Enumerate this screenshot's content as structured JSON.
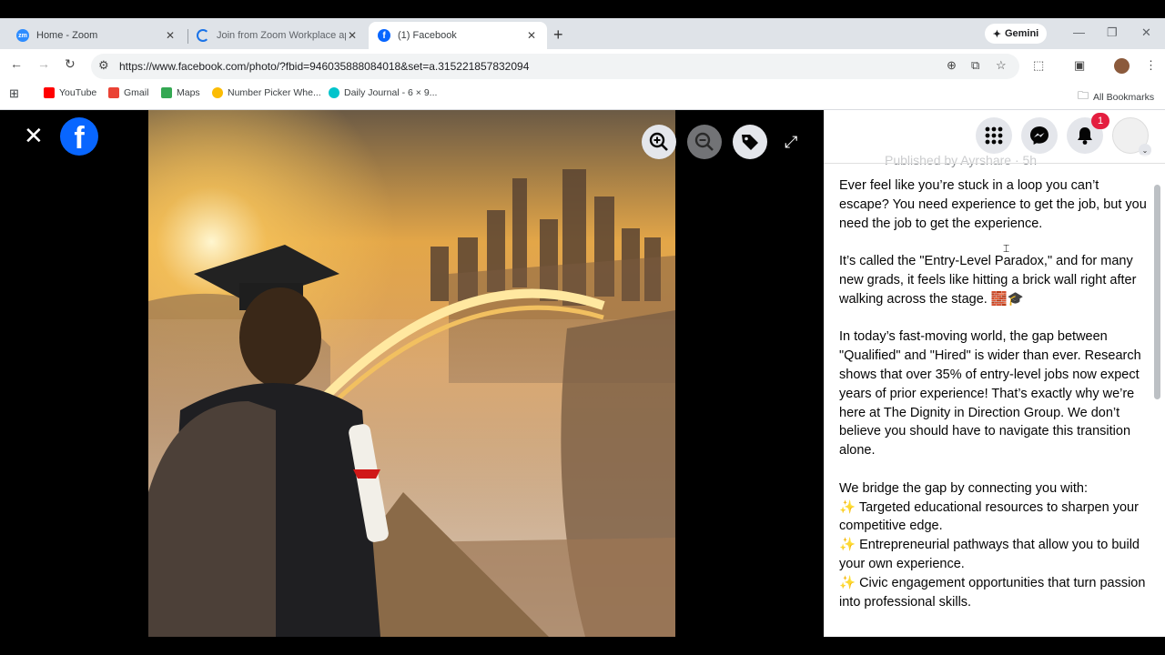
{
  "browser": {
    "tabs": [
      {
        "title": "Home - Zoom",
        "icon": "zoom-icon",
        "active": false
      },
      {
        "title": "Join from Zoom Workplace app",
        "icon": "loading-icon",
        "active": false
      },
      {
        "title": "(1) Facebook",
        "icon": "facebook-icon",
        "active": true
      }
    ],
    "new_tab": "+",
    "gemini_label": "Gemini",
    "url": "https://www.facebook.com/photo/?fbid=946035888084018&set=a.315221857832094",
    "bookmarks": [
      {
        "label": "YouTube",
        "icon": "youtube-icon",
        "color": "#ff0000"
      },
      {
        "label": "Gmail",
        "icon": "gmail-icon",
        "color": "#ea4335"
      },
      {
        "label": "Maps",
        "icon": "maps-icon",
        "color": "#34a853"
      },
      {
        "label": "Number Picker Whe...",
        "icon": "wheel-icon",
        "color": "#fbbc04"
      },
      {
        "label": "Daily Journal - 6 × 9...",
        "icon": "canva-icon",
        "color": "#00c4cc"
      }
    ],
    "all_bookmarks": "All Bookmarks"
  },
  "viewer": {
    "close": "✕",
    "logo": "f"
  },
  "header": {
    "notification_count": "1"
  },
  "post": {
    "published_by": "Published by Ayrshare · 5h",
    "paragraphs": [
      "Ever feel like you’re stuck in a loop you can’t escape? You need experience to get the job, but you need the job to get the experience.",
      "It’s called the \"Entry-Level Paradox,\" and for many new grads, it feels like hitting a brick wall right after walking across the stage. 🧱🎓",
      "In today’s fast-moving world, the gap between \"Qualified\" and \"Hired\" is wider than ever. Research shows that over 35% of entry-level jobs now expect years of prior experience! That’s exactly why we’re here at The Dignity in Direction Group. We don’t believe you should have to navigate this transition alone."
    ],
    "list_intro": "We bridge the gap by connecting you with:",
    "list_items": [
      "✨ Targeted educational resources to sharpen your competitive edge.",
      "✨ Entrepreneurial pathways that allow you to build your own experience.",
      "✨ Civic engagement opportunities that turn passion into professional skills."
    ]
  },
  "colors": {
    "facebook_blue": "#0866ff",
    "badge_red": "#e41e3f"
  }
}
